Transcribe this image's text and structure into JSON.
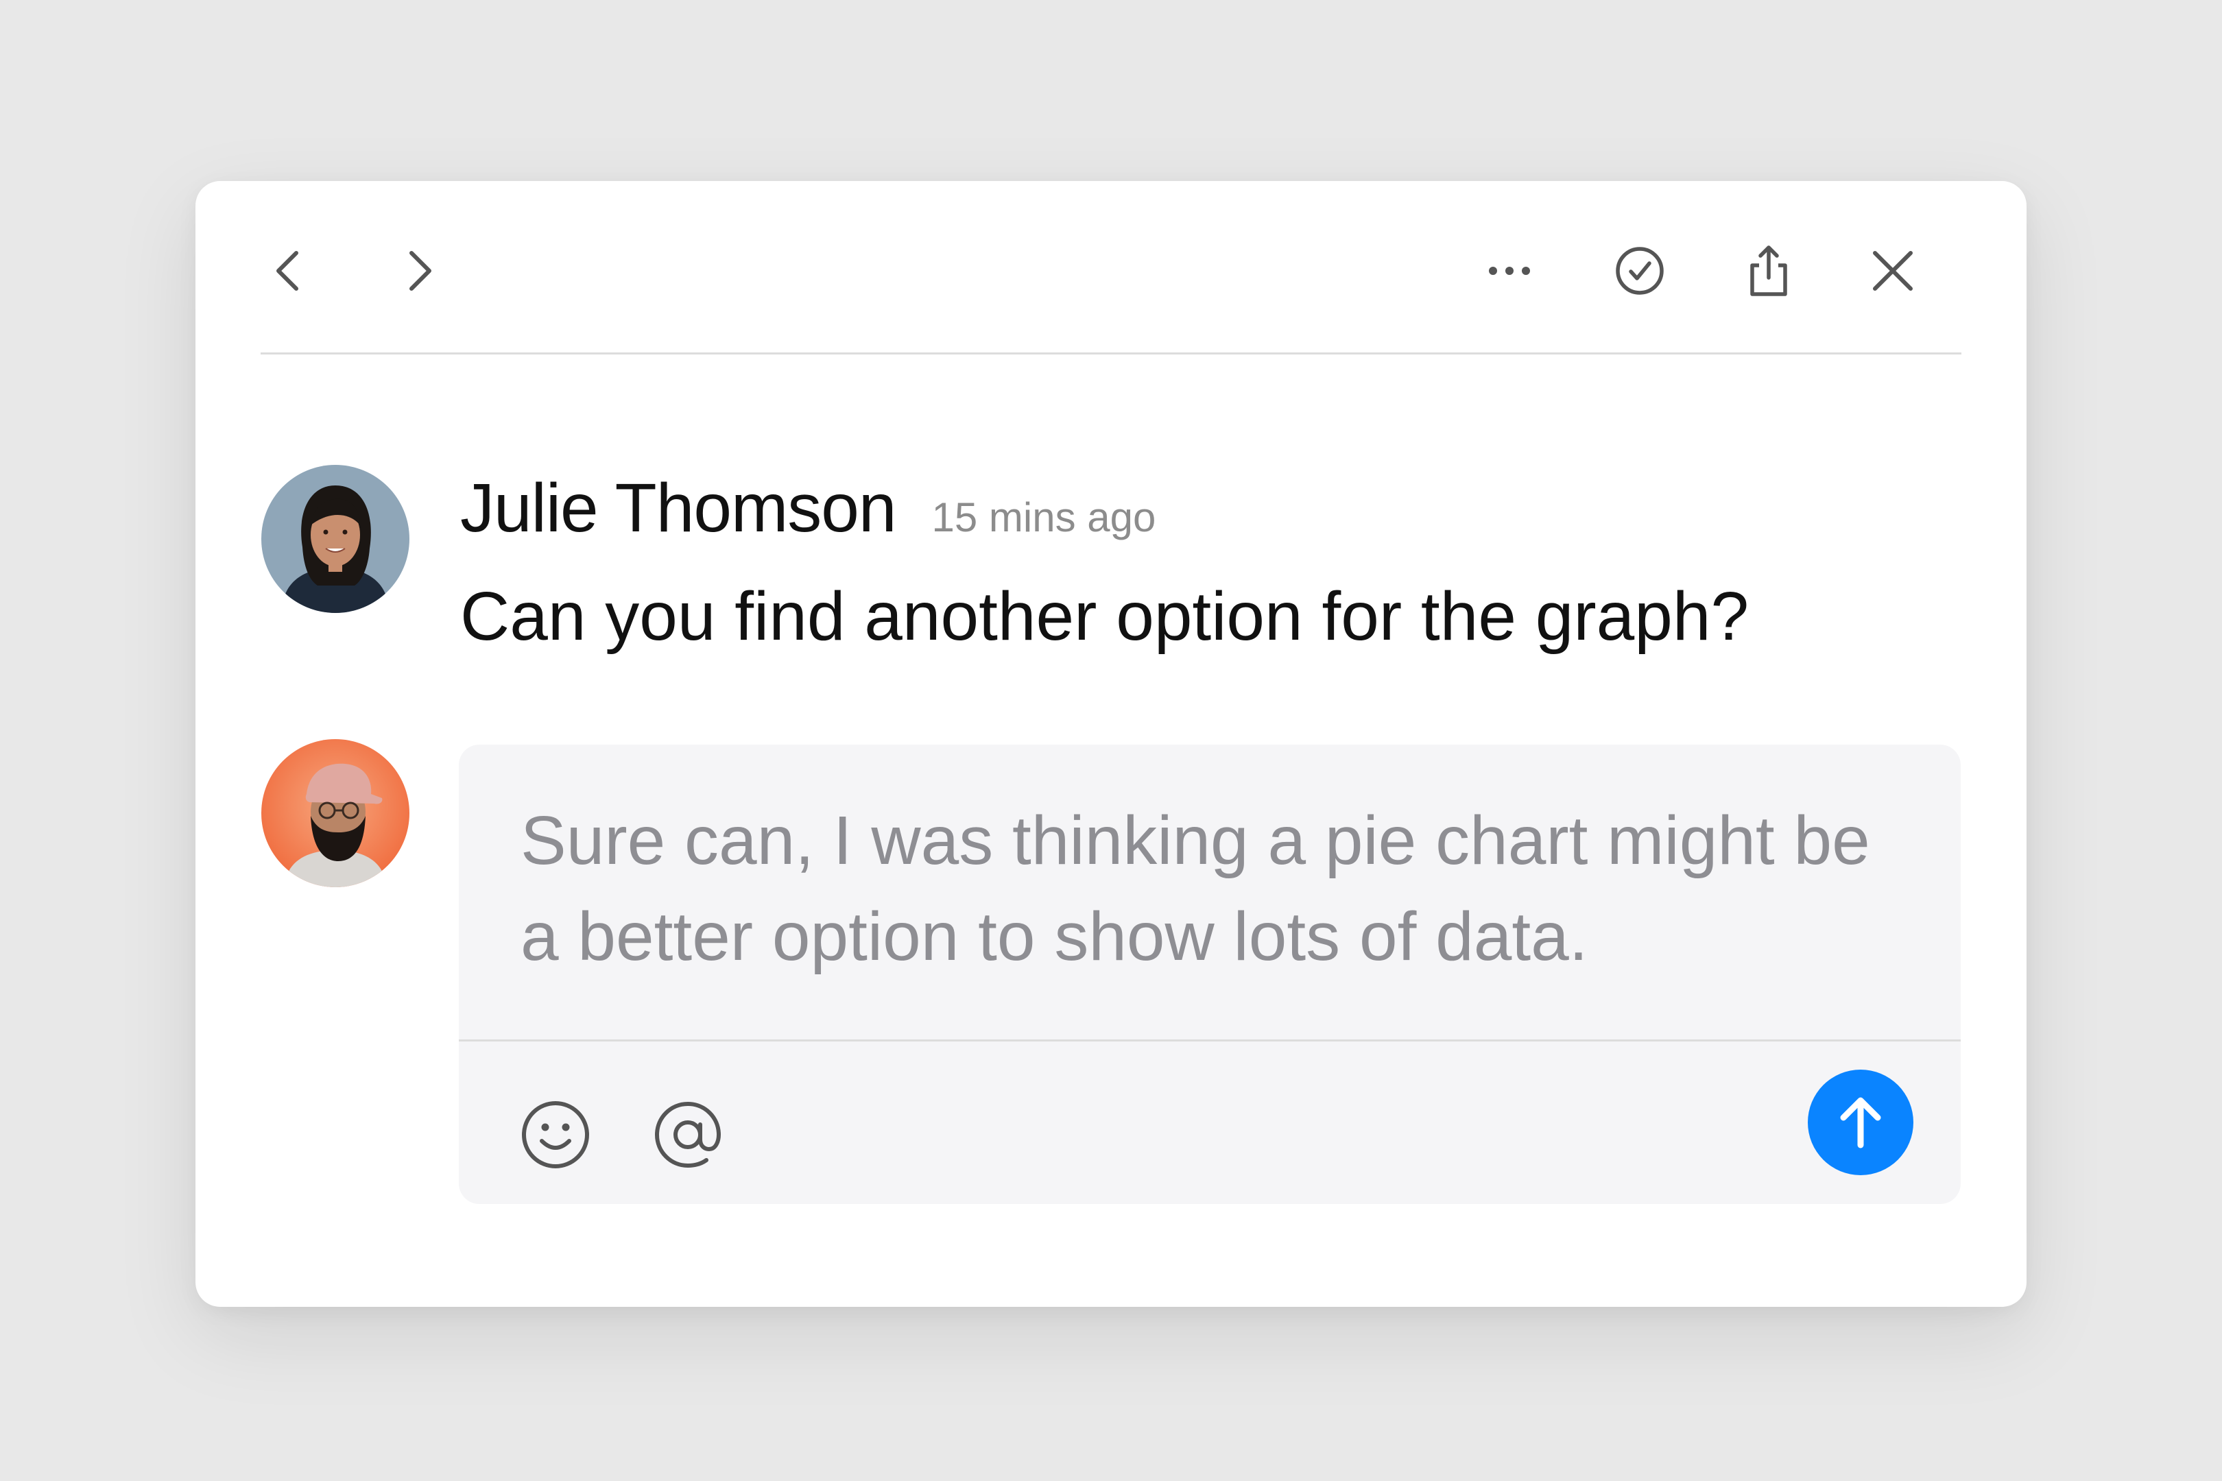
{
  "toolbar": {
    "icons": [
      "chevron-left-icon",
      "chevron-right-icon",
      "more-horizontal-icon",
      "check-circle-icon",
      "share-icon",
      "close-icon"
    ]
  },
  "comment": {
    "author": "Julie Thomson",
    "timestamp": "15 mins ago",
    "body": "Can you find another option for the graph?"
  },
  "reply": {
    "text": "Sure can, I was thinking a pie chart might be a better option to show lots of data.",
    "tools": [
      "smiley-icon",
      "at-sign-icon"
    ],
    "send_icon": "arrow-up-icon"
  },
  "colors": {
    "accent": "#0a84ff",
    "background": "#e8e8e8",
    "card": "#ffffff",
    "reply_box": "#f5f5f7",
    "muted_text": "#8e8e93",
    "icon": "#555555"
  }
}
